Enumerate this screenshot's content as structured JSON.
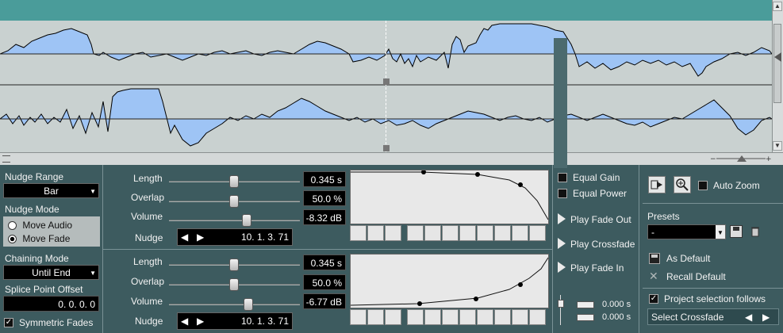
{
  "left_panel": {
    "nudge_range_label": "Nudge Range",
    "nudge_range_value": "Bar",
    "nudge_mode_label": "Nudge Mode",
    "mode_options": [
      "Move Audio",
      "Move Fade"
    ],
    "chaining_mode_label": "Chaining Mode",
    "chaining_mode_value": "Until End",
    "splice_point_label": "Splice Point Offset",
    "splice_point_value": "0. 0. 0. 0",
    "symmetric_fades_label": "Symmetric Fades"
  },
  "fade_out": {
    "length_label": "Length",
    "length_value": "0.345 s",
    "overlap_label": "Overlap",
    "overlap_value": "50.0 %",
    "volume_label": "Volume",
    "volume_value": "-8.32 dB",
    "nudge_label": "Nudge",
    "nudge_value": "10. 1. 3. 71",
    "length_level": 0.55,
    "overlap_level": 0.55,
    "volume_level": 0.68
  },
  "fade_in": {
    "length_label": "Length",
    "length_value": "0.345 s",
    "overlap_label": "Overlap",
    "overlap_value": "50.0 %",
    "volume_label": "Volume",
    "volume_value": "-6.77 dB",
    "nudge_label": "Nudge",
    "nudge_value": "10. 1. 3. 71",
    "length_level": 0.55,
    "overlap_level": 0.55,
    "volume_level": 0.7
  },
  "middle": {
    "equal_gain_label": "Equal Gain",
    "equal_power_label": "Equal Power",
    "play_fade_out": "Play Fade Out",
    "play_crossfade": "Play Crossfade",
    "play_fade_in": "Play Fade In",
    "pre_roll_value": "0.000 s",
    "post_roll_value": "0.000 s"
  },
  "right_panel": {
    "auto_zoom_label": "Auto Zoom",
    "presets_label": "Presets",
    "preset_value": "-",
    "as_default_label": "As Default",
    "recall_default_label": "Recall Default",
    "project_selection_label": "Project selection follows",
    "select_crossfade_label": "Select Crossfade"
  },
  "icons": {
    "move": "arrow-right-box-icon",
    "zoom": "magnifier-plus-icon",
    "save": "floppy-disk-icon",
    "delete": "trash-icon",
    "recall": "x-cross-icon"
  },
  "colors": {
    "waveform_fill": "#9ec4f5",
    "waveform_bg": "#c9d1d0",
    "panel_bg": "#3d5b5f",
    "top_bar": "#4a9c9a"
  }
}
